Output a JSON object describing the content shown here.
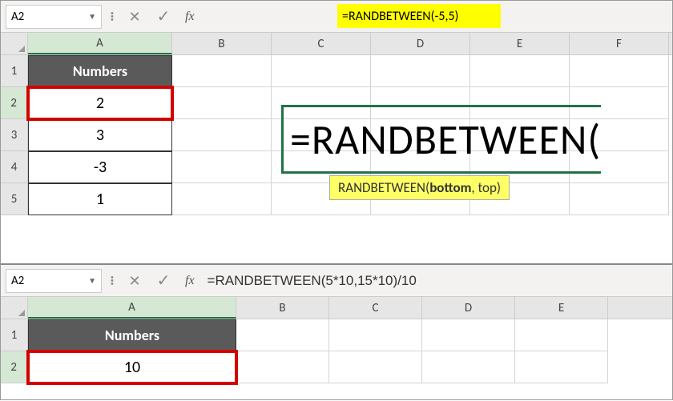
{
  "section1": {
    "nameBox": "A2",
    "formula": "=RANDBETWEEN(-5,5)",
    "columns": [
      "A",
      "B",
      "C",
      "D",
      "E",
      "F"
    ],
    "rows": [
      "1",
      "2",
      "3",
      "4",
      "5"
    ],
    "header": "Numbers",
    "values": [
      "2",
      "3",
      "-3",
      "1"
    ],
    "bigFormula": "=RANDBETWEEN(",
    "tooltip": {
      "fn": "RANDBETWEEN(",
      "arg1": "bottom",
      "sep": ", top)"
    }
  },
  "section2": {
    "nameBox": "A2",
    "formula": "=RANDBETWEEN(5*10,15*10)/10",
    "columns": [
      "A",
      "B",
      "C",
      "D",
      "E"
    ],
    "rows": [
      "1",
      "2"
    ],
    "header": "Numbers",
    "value": "10"
  },
  "fxLabel": "fx"
}
